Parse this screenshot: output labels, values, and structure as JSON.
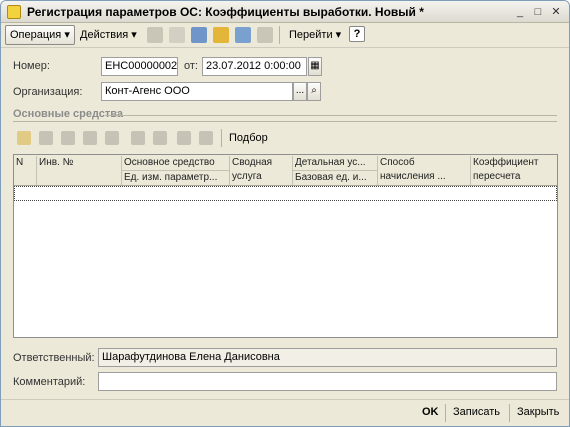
{
  "window": {
    "title": "Регистрация параметров ОС: Коэффициенты выработки. Новый *",
    "minimize": "_",
    "maximize": "□",
    "close": "✕"
  },
  "toolbar": {
    "operation": "Операция",
    "actions": "Действия",
    "goto": "Перейти",
    "help": "?"
  },
  "form": {
    "number_label": "Номер:",
    "number_value": "ЕНС00000002",
    "from_label": "от:",
    "date_value": "23.07.2012  0:00:00",
    "org_label": "Организация:",
    "org_value": "Конт-Агенс ООО",
    "select_btn": "...",
    "section_title": "Основные средства",
    "selection_btn": "Подбор",
    "responsible_label": "Ответственный:",
    "responsible_value": "Шарафутдинова Елена Данисовна",
    "comment_label": "Комментарий:",
    "comment_value": ""
  },
  "table": {
    "columns": [
      {
        "top": "N",
        "bottom": ""
      },
      {
        "top": "Инв. №",
        "bottom": ""
      },
      {
        "top": "Основное средство",
        "bottom": "Ед. изм. параметр..."
      },
      {
        "top": "Сводная",
        "bottom": "услуга"
      },
      {
        "top": "Детальная ус...",
        "bottom": "Базовая  ед. и..."
      },
      {
        "top": "Способ",
        "bottom": "начисления ..."
      },
      {
        "top": "Коэффициент",
        "bottom": "пересчета"
      }
    ],
    "rows": []
  },
  "footer": {
    "ok": "OK",
    "save": "Записать",
    "close": "Закрыть"
  },
  "colors": {
    "window_bg": "#ece9d8",
    "section_title": "#8c8c8c",
    "field_border": "#9e9e9e"
  }
}
